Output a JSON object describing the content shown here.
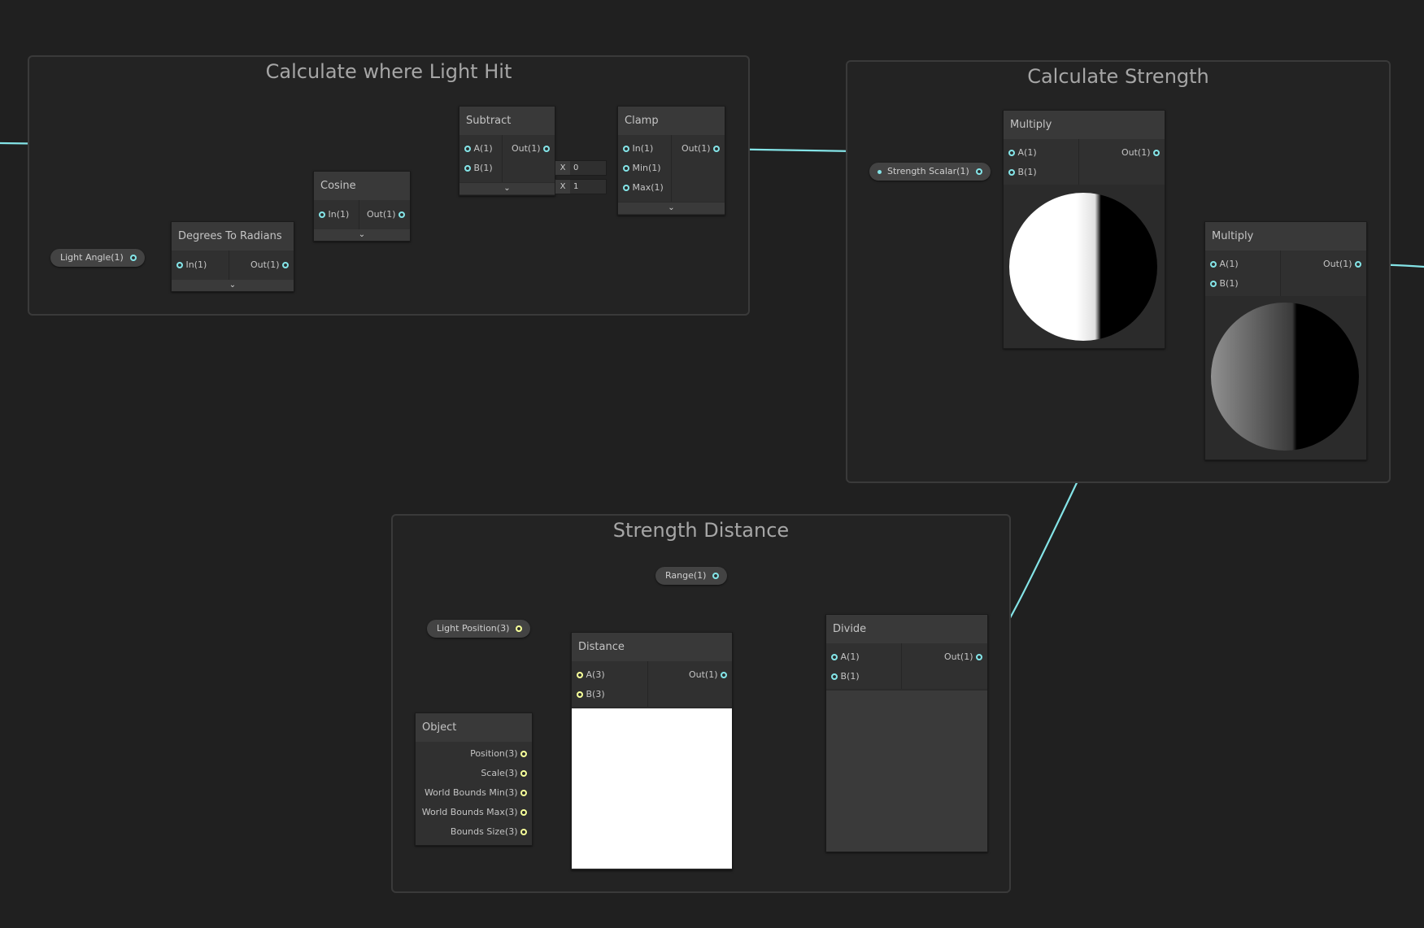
{
  "colors": {
    "float_wire": "#84e4e7",
    "vector3_wire": "#f6ff9a",
    "background": "#202020"
  },
  "groups": {
    "light_hit": {
      "title": "Calculate where Light Hit"
    },
    "strength": {
      "title": "Calculate Strength"
    },
    "distance": {
      "title": "Strength Distance"
    }
  },
  "properties": {
    "light_angle": "Light Angle(1)",
    "strength_scalar": "Strength Scalar(1)",
    "range": "Range(1)",
    "light_position": "Light Position(3)"
  },
  "nodes": {
    "degrees_to_radians": {
      "title": "Degrees To Radians",
      "inputs": [
        "In(1)"
      ],
      "outputs": [
        "Out(1)"
      ]
    },
    "cosine": {
      "title": "Cosine",
      "inputs": [
        "In(1)"
      ],
      "outputs": [
        "Out(1)"
      ]
    },
    "subtract": {
      "title": "Subtract",
      "inputs": [
        "A(1)",
        "B(1)"
      ],
      "outputs": [
        "Out(1)"
      ]
    },
    "clamp": {
      "title": "Clamp",
      "inputs": [
        "In(1)",
        "Min(1)",
        "Max(1)"
      ],
      "outputs": [
        "Out(1)"
      ],
      "min_label": "X",
      "min_value": "0",
      "max_label": "X",
      "max_value": "1"
    },
    "multiply_1": {
      "title": "Multiply",
      "inputs": [
        "A(1)",
        "B(1)"
      ],
      "outputs": [
        "Out(1)"
      ]
    },
    "multiply_2": {
      "title": "Multiply",
      "inputs": [
        "A(1)",
        "B(1)"
      ],
      "outputs": [
        "Out(1)"
      ]
    },
    "distance": {
      "title": "Distance",
      "inputs": [
        "A(3)",
        "B(3)"
      ],
      "outputs": [
        "Out(1)"
      ]
    },
    "divide": {
      "title": "Divide",
      "inputs": [
        "A(1)",
        "B(1)"
      ],
      "outputs": [
        "Out(1)"
      ]
    },
    "object": {
      "title": "Object",
      "outputs": [
        "Position(3)",
        "Scale(3)",
        "World Bounds Min(3)",
        "World Bounds Max(3)",
        "Bounds Size(3)"
      ]
    }
  },
  "collapse_glyph": "⌄"
}
